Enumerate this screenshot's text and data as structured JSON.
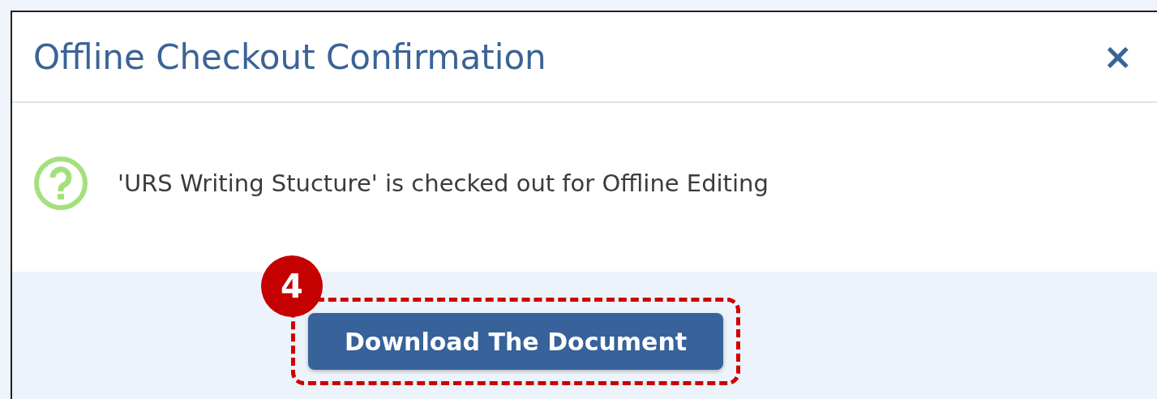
{
  "dialog": {
    "title": "Offline Checkout Confirmation",
    "close": "×",
    "message": "'URS Writing Stucture' is checked out for Offline Editing",
    "button": {
      "label": "Download The Document"
    },
    "callout": {
      "number": "4"
    }
  }
}
